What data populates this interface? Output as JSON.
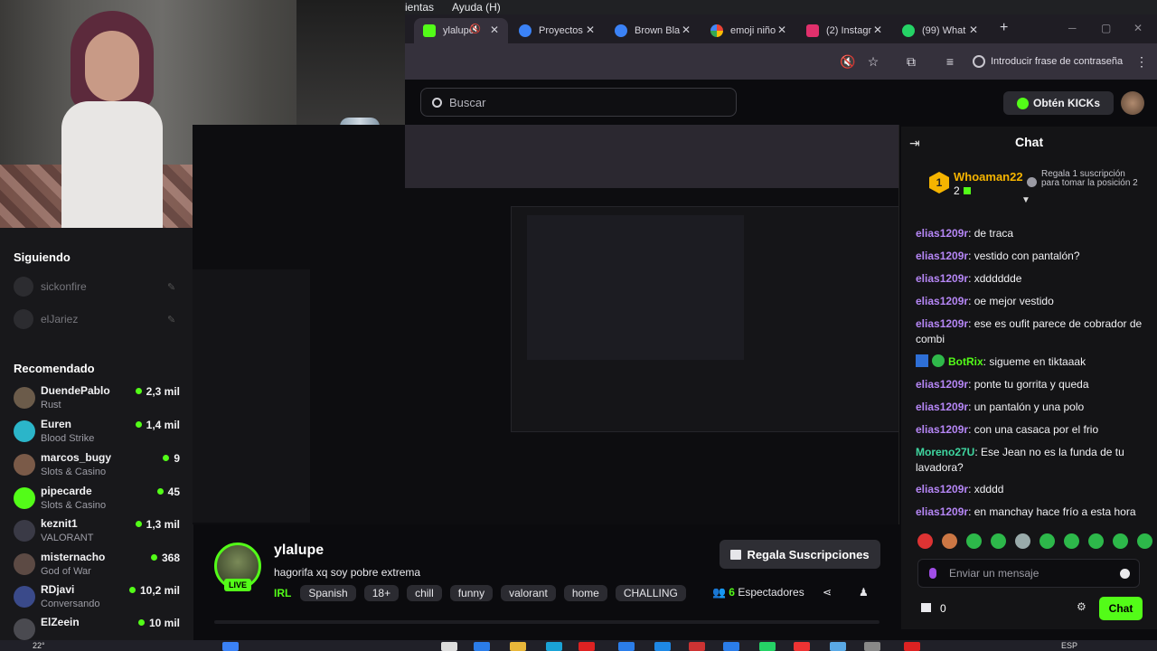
{
  "browser": {
    "menu": [
      "ientas",
      "Ayuda (H)"
    ],
    "tabs": [
      {
        "title": "ylalupe",
        "color": "#53fc18",
        "active": true
      },
      {
        "title": "Proyectos",
        "color": "#3b82f6"
      },
      {
        "title": "Brown Bla",
        "color": "#3b82f6"
      },
      {
        "title": "emoji niño",
        "color": "#4285f4"
      },
      {
        "title": "(2) Instagr",
        "color": "#e1306c"
      },
      {
        "title": "(99) What",
        "color": "#25d366"
      }
    ],
    "password_prompt": "Introducir frase de contraseña"
  },
  "header": {
    "search_placeholder": "Buscar",
    "get_kicks": "Obtén KICKs"
  },
  "sidebar": {
    "following_title": "Siguiendo",
    "following": [
      "sickonfire",
      "elJariez"
    ],
    "recommended_title": "Recomendado",
    "recommended": [
      {
        "name": "DuendePablo",
        "category": "Rust",
        "viewers": "2,3 mil",
        "color": "#6b5b4a"
      },
      {
        "name": "Euren",
        "category": "Blood Strike",
        "viewers": "1,4 mil",
        "color": "#2bb5c9"
      },
      {
        "name": "marcos_bugy",
        "category": "Slots & Casino",
        "viewers": "9",
        "color": "#7a5a48"
      },
      {
        "name": "pipecarde",
        "category": "Slots & Casino",
        "viewers": "45",
        "color": "#53fc18"
      },
      {
        "name": "keznit1",
        "category": "VALORANT",
        "viewers": "1,3 mil",
        "color": "#3a3a46"
      },
      {
        "name": "misternacho",
        "category": "God of War",
        "viewers": "368",
        "color": "#5c4a44"
      },
      {
        "name": "RDjavi",
        "category": "Conversando",
        "viewers": "10,2 mil",
        "color": "#3a4a8a"
      },
      {
        "name": "ElZeein",
        "category": "",
        "viewers": "10 mil",
        "color": "#4a4a50"
      }
    ]
  },
  "stream": {
    "name": "ylalupe",
    "title": "hagorifa xq soy pobre extrema",
    "live": "LIVE",
    "category": "IRL",
    "tags": [
      "Spanish",
      "18+",
      "chill",
      "funny",
      "valorant",
      "home",
      "CHALLING"
    ],
    "gift_button": "Regala Suscripciones",
    "viewer_count": "6",
    "viewer_label": "Espectadores"
  },
  "chat": {
    "title": "Chat",
    "pinned": {
      "rank": "1",
      "user": "Whoaman22",
      "count": "2",
      "text": "Regala 1 suscripción para tomar la posición 2"
    },
    "messages": [
      {
        "user": "elias1209r",
        "text": "de traca",
        "color": "#b586f5"
      },
      {
        "user": "elias1209r",
        "text": "vestido con pantalón?",
        "color": "#b586f5"
      },
      {
        "user": "elias1209r",
        "text": "xdddddde",
        "color": "#b586f5"
      },
      {
        "user": "elias1209r",
        "text": "oe mejor vestido",
        "color": "#b586f5"
      },
      {
        "user": "elias1209r",
        "text": "ese es oufit parece de cobrador de combi",
        "color": "#b586f5"
      },
      {
        "user": "BotRix",
        "text": "sigueme en tiktaaak",
        "color": "#53fc18"
      },
      {
        "user": "elias1209r",
        "text": "ponte tu gorrita y queda",
        "color": "#b586f5"
      },
      {
        "user": "elias1209r",
        "text": "un pantalón y una polo",
        "color": "#b586f5"
      },
      {
        "user": "elias1209r",
        "text": "con una casaca por el frio",
        "color": "#b586f5"
      },
      {
        "user": "Moreno27U",
        "text": "Ese Jean no es la funda de tu lavadora?",
        "color": "#3fd6a0"
      },
      {
        "user": "elias1209r",
        "text": "xdddd",
        "color": "#b586f5"
      },
      {
        "user": "elias1209r",
        "text": "en manchay hace frío a esta hora",
        "color": "#b586f5"
      }
    ],
    "input_placeholder": "Enviar un mensaje",
    "kicks_count": "0",
    "send_button": "Chat"
  },
  "taskbar": {
    "temperature": "22°",
    "language": "ESP"
  }
}
